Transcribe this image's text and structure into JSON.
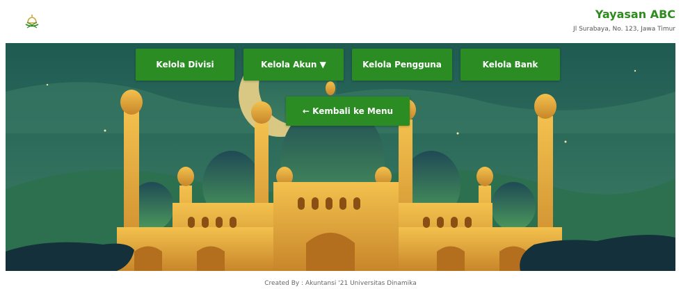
{
  "header": {
    "logo_icon": "mosque-logo-icon",
    "org_name": "Yayasan ABC",
    "org_address": "Jl Surabaya, No. 123, Jawa Timur"
  },
  "nav": {
    "divisi_label": "Kelola Divisi",
    "akun_label": "Kelola Akun ▼",
    "pengguna_label": "Kelola Pengguna",
    "bank_label": "Kelola Bank",
    "back_label": "← Kembali ke Menu"
  },
  "footer": {
    "credit": "Created By : Akuntansi '21 Universitas Dinamika"
  },
  "colors": {
    "accent": "#2a8c23",
    "brand_text": "#2e8b1e"
  }
}
